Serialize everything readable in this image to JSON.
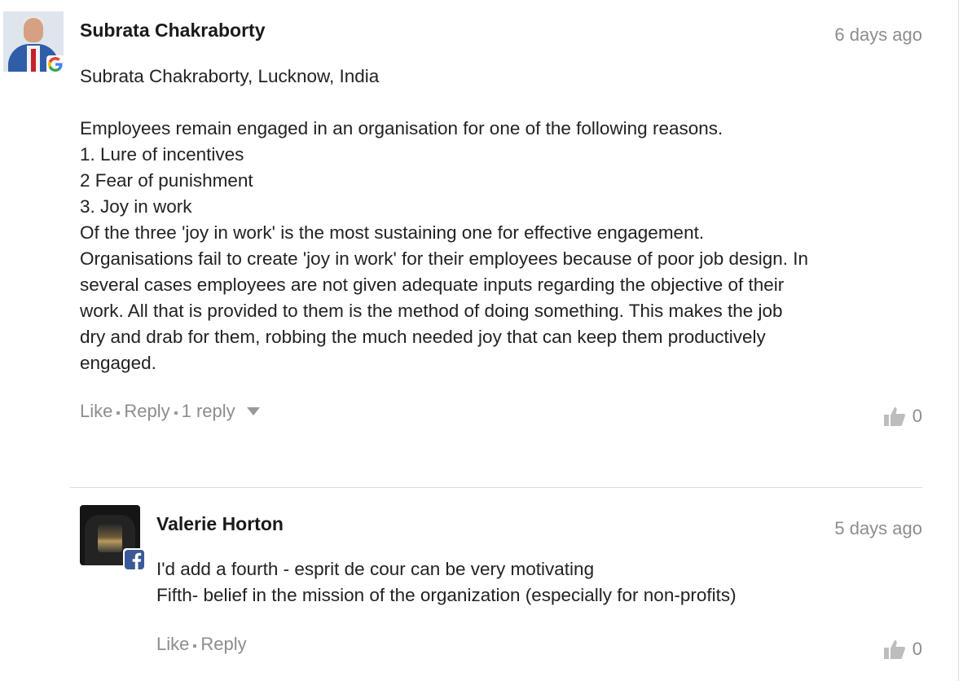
{
  "comments": [
    {
      "author": "Subrata Chakraborty",
      "time": "6 days ago",
      "avatar_icon": "user-avatar-photo",
      "badge_icon": "google-icon",
      "body": "Subrata Chakraborty, Lucknow, India\n\nEmployees remain engaged in an organisation for one of the following reasons.\n1. Lure of incentives\n2 Fear of punishment\n3. Joy in work\nOf the three 'joy in work' is the most sustaining one for effective engagement.\nOrganisations fail to create 'joy in work' for their employees because of poor job design. In\nseveral cases employees are not given adequate inputs regarding the objective of their\nwork. All that is provided to them is the method of doing something. This makes the job\ndry and drab for them, robbing the much needed joy that can keep them productively\nengaged.",
      "actions": {
        "like": "Like",
        "reply": "Reply",
        "replies": "1 reply"
      },
      "likes": "0"
    },
    {
      "author": "Valerie Horton",
      "time": "5 days ago",
      "avatar_icon": "user-avatar-photo",
      "badge_icon": "facebook-icon",
      "body": "I'd add a fourth - esprit de cour can be very motivating\nFifth- belief in the mission of the organization (especially for non-profits)",
      "actions": {
        "like": "Like",
        "reply": "Reply"
      },
      "likes": "0"
    }
  ],
  "colors": {
    "meta_text": "#8d8d8d",
    "body_text": "#222222",
    "author_text": "#1a1a1a",
    "facebook_blue": "#3b5998",
    "divider": "#dcdcdc"
  }
}
